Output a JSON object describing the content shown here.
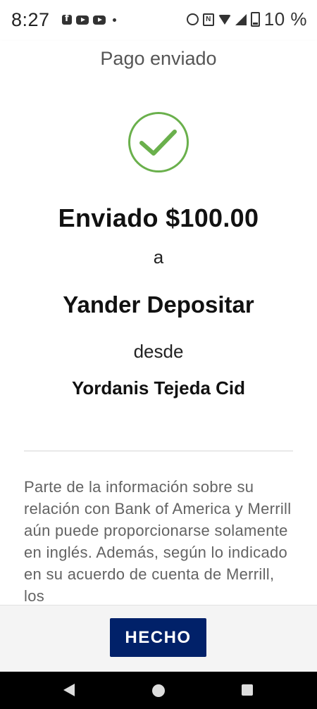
{
  "status_bar": {
    "time": "8:27",
    "battery": "10 %",
    "left_icons": [
      "facebook-icon",
      "youtube-icon",
      "youtube-icon",
      "dot-icon"
    ],
    "right_icons": [
      "alarm-icon",
      "nfc-icon",
      "wifi-icon",
      "signal-icon",
      "battery-icon"
    ]
  },
  "header": {
    "title": "Pago enviado"
  },
  "confirmation": {
    "headline": "Enviado $100.00",
    "connector_to": "a",
    "recipient": "Yander Depositar",
    "connector_from": "desde",
    "sender": "Yordanis Tejeda Cid",
    "check_color": "#6ab04c"
  },
  "disclaimer": {
    "text": "Parte de la información sobre su relación con Bank of America y Merrill aún puede proporcionarse solamente en inglés. Además, según lo indicado en su acuerdo de cuenta de Merrill, los"
  },
  "footer": {
    "done_label": "HECHO",
    "button_color": "#012169"
  },
  "nav_bar": {
    "icons": [
      "back-icon",
      "home-icon",
      "recents-icon"
    ]
  }
}
